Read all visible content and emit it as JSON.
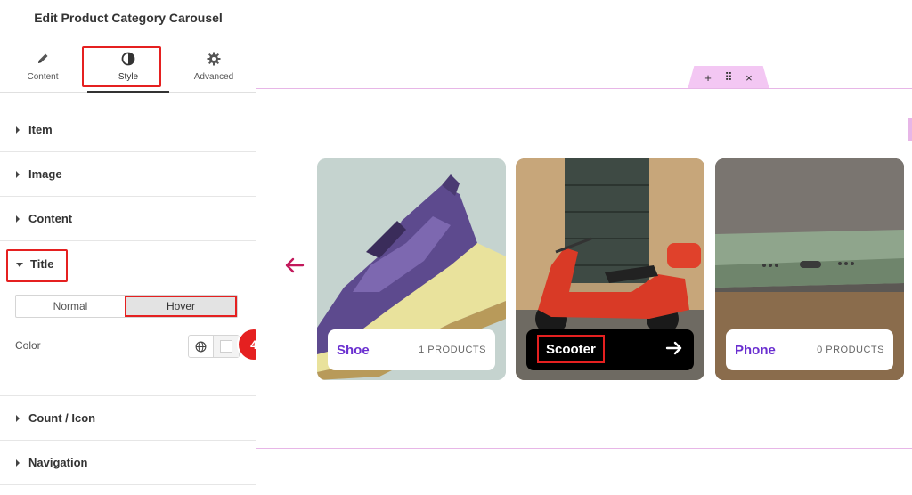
{
  "panel": {
    "title": "Edit Product Category Carousel",
    "tabs": [
      {
        "label": "Content",
        "icon": "pencil-icon"
      },
      {
        "label": "Style",
        "icon": "contrast-icon",
        "active": true
      },
      {
        "label": "Advanced",
        "icon": "gear-icon"
      }
    ],
    "sections": {
      "item": "Item",
      "image": "Image",
      "content": "Content",
      "title": "Title",
      "count_icon": "Count / Icon",
      "navigation": "Navigation"
    },
    "title_controls": {
      "normal": "Normal",
      "hover": "Hover",
      "color_label": "Color"
    },
    "step_badge": "4"
  },
  "canvas": {
    "handle": {
      "add": "+",
      "move": "⠿",
      "close": "×"
    },
    "cards": [
      {
        "name": "Shoe",
        "count": "1 PRODUCTS"
      },
      {
        "name": "Scooter",
        "arrow": "→"
      },
      {
        "name": "Phone",
        "count": "0 PRODUCTS"
      }
    ]
  },
  "colors": {
    "accent_purple": "#6a2fd0",
    "highlight_red": "#e52020",
    "frame_pink": "#e7b6e7",
    "nav_arrow": "#c2185b"
  }
}
